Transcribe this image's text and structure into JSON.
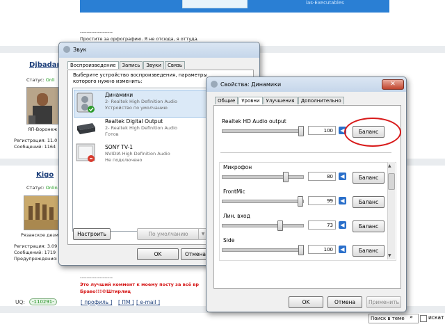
{
  "forum": {
    "signature1": "Простите за орфографию. Я не отсюда, я оттуда.",
    "banner_text": "ias-Executables",
    "user1": {
      "name": "Djbadan",
      "status_label": "Статус:",
      "status_value": "Onli",
      "location": "ЯП-Воронеж",
      "reg": "Регистрация: 11.0",
      "msgs": "Сообщений: 1164"
    },
    "user2": {
      "name": "Kigo",
      "status_label": "Статус:",
      "status_value": "Onlin",
      "location": "Рязанское дезм",
      "reg": "Регистрация: 3.09",
      "msgs": "Сообщений: 1719",
      "warn": "Предупреждения:"
    },
    "dashes": "--------------------",
    "quote_line1": "Это лучший коммент к моему посту за всё вр",
    "quote_line2": "Браво!!!©Штирлиц",
    "uq_label": "UQ:",
    "uq_badge": "110291",
    "links": [
      "[ профиль ]",
      "[ ПМ ]",
      "[ e-mail ]"
    ],
    "search_placeholder": "Поиск в теме",
    "search_arrow": "»",
    "search_label": "искат"
  },
  "sound_window": {
    "title": "Звук",
    "tabs": [
      "Воспроизведение",
      "Запись",
      "Звуки",
      "Связь"
    ],
    "instruction": "Выберите устройство воспроизведения, параметры которого нужно изменить:",
    "devices": [
      {
        "name": "Динамики",
        "sub1": "2- Realtek High Definition Audio",
        "sub2": "Устройство по умолчанию"
      },
      {
        "name": "Realtek Digital Output",
        "sub1": "2- Realtek High Definition Audio",
        "sub2": "Готов"
      },
      {
        "name": "SONY TV-1",
        "sub1": "NVIDIA High Definition Audio",
        "sub2": "Не подключено"
      }
    ],
    "configure_label": "Настроить",
    "default_label": "По умолчанию",
    "ok_label": "OK",
    "cancel_label": "Отмена"
  },
  "props_window": {
    "title": "Свойства: Динамики",
    "tabs": [
      "Общие",
      "Уровни",
      "Улучшения",
      "Дополнительно"
    ],
    "main_channel": {
      "name": "Realtek HD Audio output",
      "value": "100",
      "level": 1.0,
      "balance_label": "Баланс"
    },
    "channels": [
      {
        "name": "Микрофон",
        "value": "80",
        "level": 0.8,
        "balance_label": "Баланс"
      },
      {
        "name": "FrontMic",
        "value": "99",
        "level": 0.99,
        "balance_label": "Баланс"
      },
      {
        "name": "Лин. вход",
        "value": "73",
        "level": 0.73,
        "balance_label": "Баланс"
      },
      {
        "name": "Side",
        "value": "100",
        "level": 1.0,
        "balance_label": "Баланс"
      }
    ],
    "ok_label": "OK",
    "cancel_label": "Отмена",
    "apply_label": "Применить",
    "highlight_color": "#d81b1b"
  }
}
